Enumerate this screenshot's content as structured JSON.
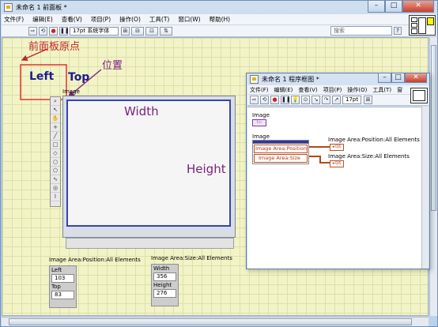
{
  "main_window": {
    "title": "未命名 1 前面板 *",
    "menus": [
      "文件(F)",
      "编辑(E)",
      "查看(V)",
      "项目(P)",
      "操作(O)",
      "工具(T)",
      "窗口(W)",
      "帮助(H)"
    ],
    "font_selector": "17pt 系统字体",
    "search_placeholder": "搜索"
  },
  "annotations": {
    "origin": "前面板原点",
    "position": "位置",
    "left": "Left",
    "top": "Top",
    "width": "Width",
    "height": "Height"
  },
  "image_control": {
    "label": "Image"
  },
  "position_indicator": {
    "label": "Image Area:Position:All Elements",
    "fields": [
      {
        "name": "Left",
        "value": "103"
      },
      {
        "name": "Top",
        "value": "83"
      }
    ]
  },
  "size_indicator": {
    "label": "Image Area:Size:All Elements",
    "fields": [
      {
        "name": "Width",
        "value": "356"
      },
      {
        "name": "Height",
        "value": "276"
      }
    ]
  },
  "block_diagram": {
    "title": "未命名 1 程序框图 *",
    "menus": [
      "文件(F)",
      "编辑(E)",
      "查看(V)",
      "项目(P)",
      "操作(O)",
      "工具(T)",
      "窗"
    ],
    "font_selector": "17pt",
    "terminal_label": "Image",
    "node_label": "Image",
    "prop_position": "Image Area:Position",
    "prop_size": "Image Area:Size",
    "out_position": "Image Area:Position:All Elements",
    "out_size": "Image Area:Size:All Elements"
  },
  "colors": {
    "annotation_red": "#c0242a",
    "annotation_purple": "#7a1f7f",
    "image_border": "#3645b8"
  }
}
